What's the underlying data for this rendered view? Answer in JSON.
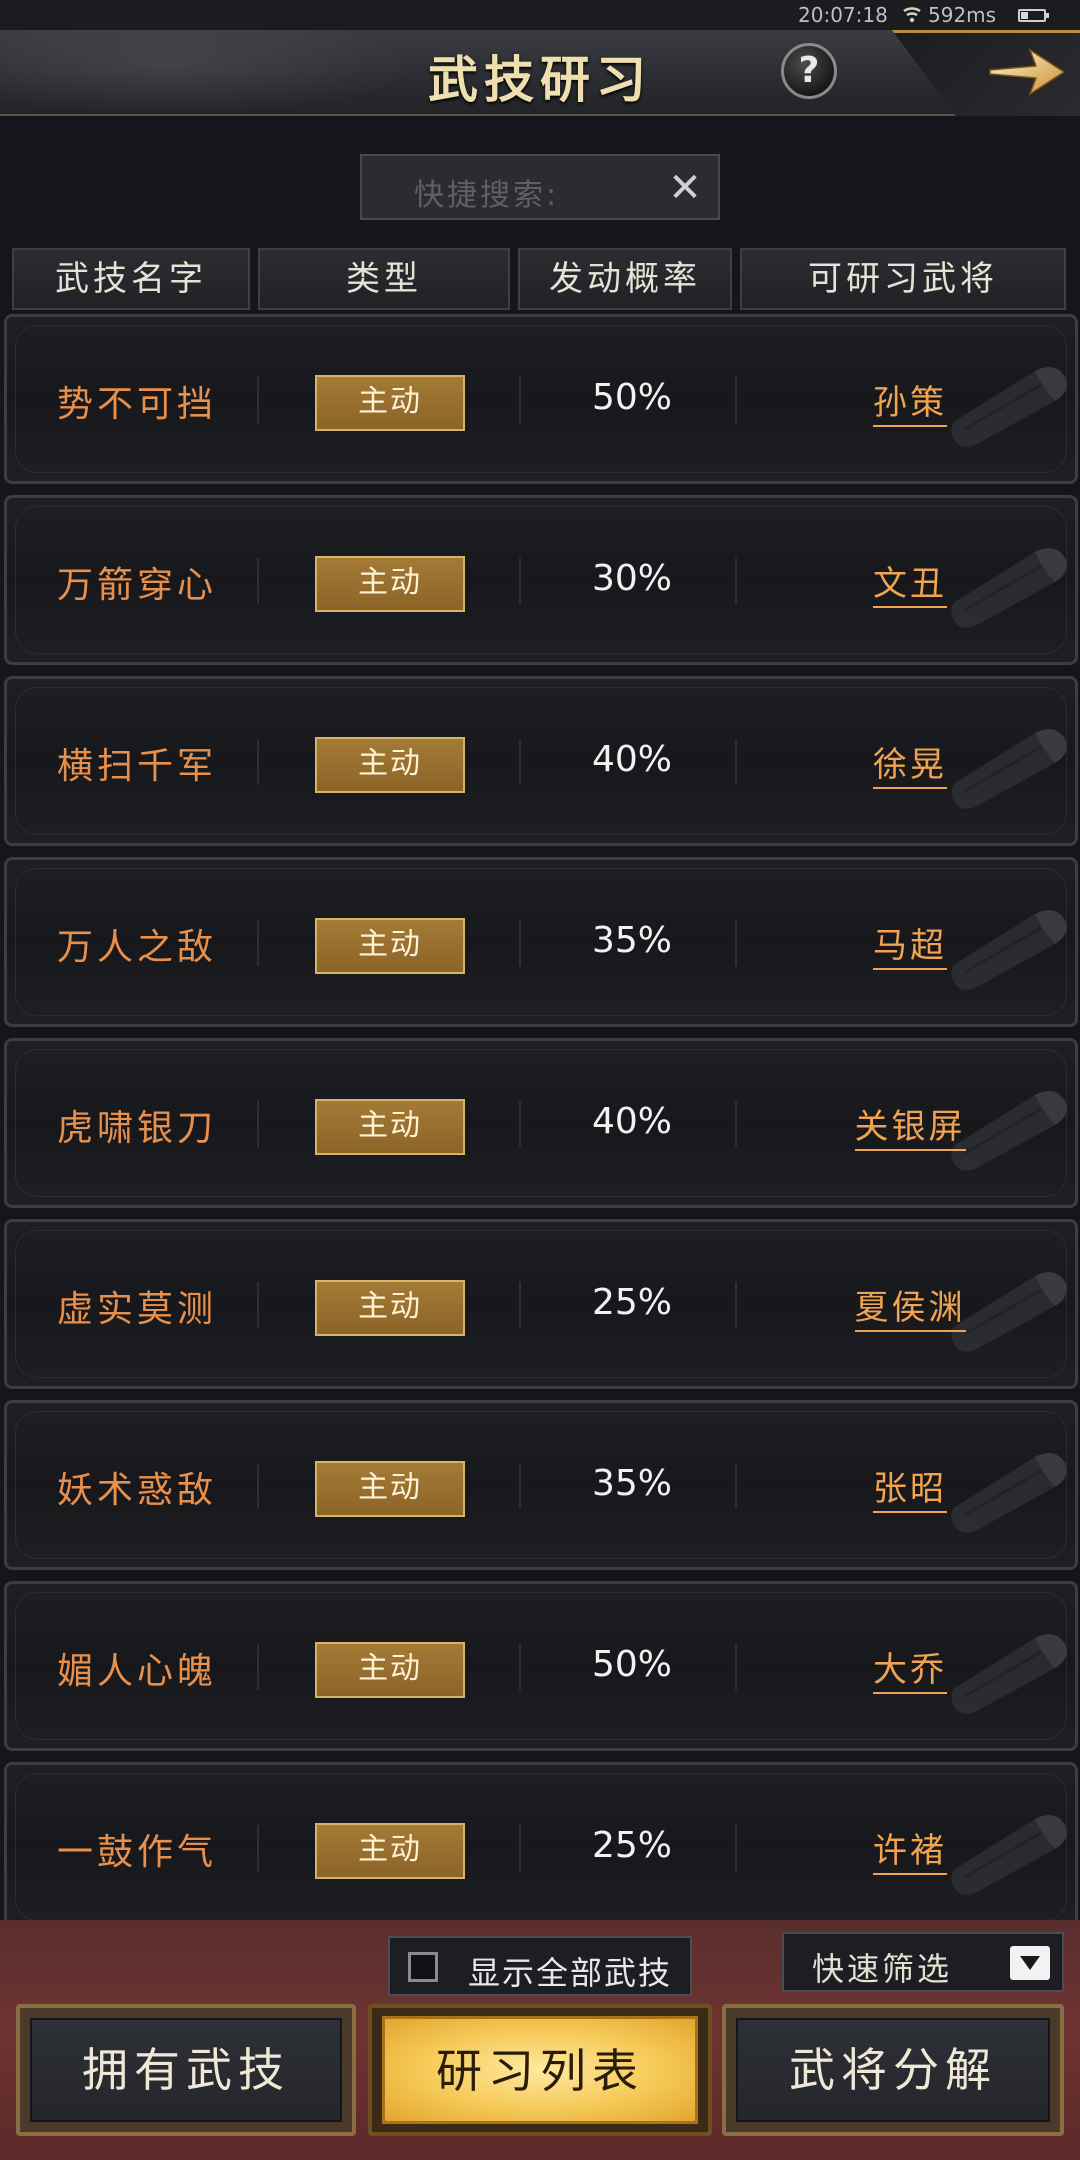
{
  "status": {
    "time": "20:07:18",
    "ping": "592ms",
    "wifi_icon": "wifi-icon",
    "battery_icon": "battery-icon"
  },
  "header": {
    "title": "武技研习",
    "help_label": "?",
    "next_icon": "arrow-right-icon"
  },
  "search": {
    "placeholder": "快捷搜索:",
    "clear_icon": "✕"
  },
  "columns": [
    "武技名字",
    "类型",
    "发动概率",
    "可研习武将"
  ],
  "skills": [
    {
      "name": "势不可挡",
      "type": "主动",
      "chance": "50%",
      "general": "孙策"
    },
    {
      "name": "万箭穿心",
      "type": "主动",
      "chance": "30%",
      "general": "文丑"
    },
    {
      "name": "横扫千军",
      "type": "主动",
      "chance": "40%",
      "general": "徐晃"
    },
    {
      "name": "万人之敌",
      "type": "主动",
      "chance": "35%",
      "general": "马超"
    },
    {
      "name": "虎啸银刀",
      "type": "主动",
      "chance": "40%",
      "general": "关银屏"
    },
    {
      "name": "虚实莫测",
      "type": "主动",
      "chance": "25%",
      "general": "夏侯渊"
    },
    {
      "name": "妖术惑敌",
      "type": "主动",
      "chance": "35%",
      "general": "张昭"
    },
    {
      "name": "媚人心魄",
      "type": "主动",
      "chance": "50%",
      "general": "大乔"
    },
    {
      "name": "一鼓作气",
      "type": "主动",
      "chance": "25%",
      "general": "许褚"
    }
  ],
  "bottom": {
    "show_all_label": "显示全部武技",
    "show_all_checked": false,
    "filter_label": "快速筛选",
    "tabs": [
      "拥有武技",
      "研习列表",
      "武将分解"
    ],
    "active_tab": "研习列表"
  },
  "colors": {
    "accent_gold": "#f5c957",
    "skill_name": "#e88f4c",
    "general_link": "#f0a350"
  }
}
